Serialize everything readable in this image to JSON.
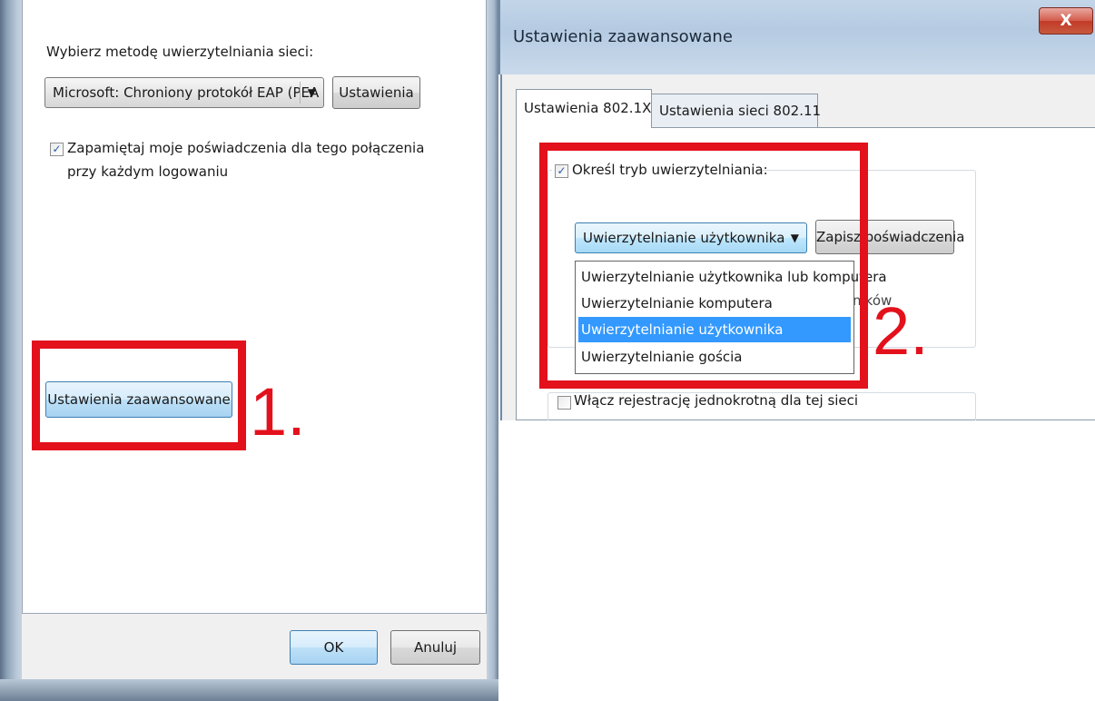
{
  "left_dialog": {
    "auth_method_label": "Wybierz metodę uwierzytelniania sieci:",
    "eap_method_value": "Microsoft: Chroniony protokół EAP (PEA",
    "settings_button": "Ustawienia",
    "remember_checkbox_checked": true,
    "remember_label_line1": "Zapamiętaj moje poświadczenia dla tego połączenia",
    "remember_label_line2": "przy każdym logowaniu",
    "advanced_button": "Ustawienia zaawansowane",
    "ok_button": "OK",
    "cancel_button": "Anuluj"
  },
  "right_dialog": {
    "title": "Ustawienia zaawansowane",
    "close_glyph": "X",
    "tabs": [
      {
        "label": "Ustawienia 802.1X",
        "active": true
      },
      {
        "label": "Ustawienia sieci 802.11",
        "active": false
      }
    ],
    "specify_auth_checked": true,
    "specify_auth_label": "Określ tryb uwierzytelniania:",
    "auth_mode_value": "Uwierzytelnianie użytkownika",
    "save_credentials_button": "Zapisz poświadczenia",
    "dropdown_options": [
      "Uwierzytelnianie użytkownika lub komputera",
      "Uwierzytelnianie komputera",
      "Uwierzytelnianie użytkownika",
      "Uwierzytelnianie gościa"
    ],
    "dropdown_selected_index": 2,
    "hidden_text_fragment": "ników",
    "sso_checked": false,
    "sso_label": "Włącz rejestrację jednokrotną dla tej sieci"
  },
  "annotations": {
    "step1": "1.",
    "step2": "2.",
    "highlight_color": "#e3111c"
  },
  "icons": {
    "dropdown_arrow": "▼",
    "checkmark": "✓"
  }
}
